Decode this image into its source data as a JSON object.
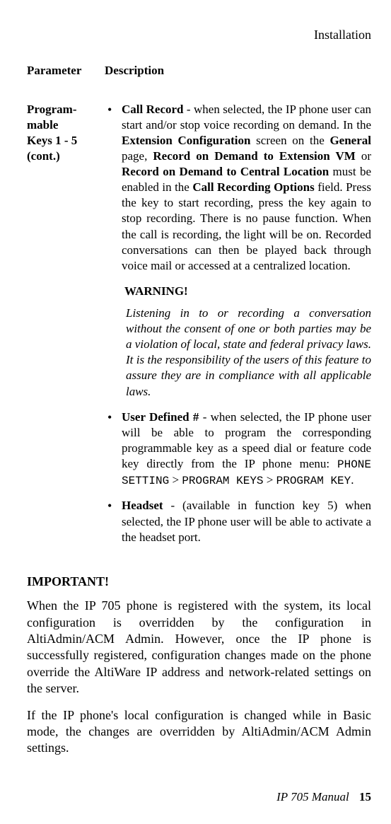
{
  "header": {
    "section": "Installation"
  },
  "table": {
    "headers": {
      "param": "Parameter",
      "desc": "Description"
    },
    "row": {
      "param": "Program-\nmable Keys 1 - 5 (cont.)"
    },
    "bullets": {
      "b1": {
        "lead": "Call Record",
        "t1": " - when selected, the IP phone user can start and/or stop voice recording on demand. In the ",
        "b2": "Extension Configuration",
        "t2": " screen on the ",
        "b3": "General",
        "t3": " page, ",
        "b4": "Record on Demand to Extension VM",
        "t4": " or ",
        "b5": "Record on Demand to Central Location",
        "t5": " must be enabled in the ",
        "b6": "Call Recording Options",
        "t6": " field. Press the key to start recording, press the key again to stop recording. There is no pause function. When the call is recording, the light will be on. Recorded conversations can then be played back through voice mail or accessed at a centralized location."
      },
      "warning": {
        "title": "WARNING!",
        "text": "Listening in to or recording a conversation without the consent of one or both parties may be a violation of local, state and federal privacy laws. It is the responsibility of the users of this feature to assure they are in compliance with all applicable laws."
      },
      "b2": {
        "lead": "User Defined #",
        "t1": " - when selected, the IP phone user will be able to program the corresponding programmable key as a speed dial or feature code key directly from the IP phone menu: ",
        "m1": "PHONE SETTING",
        "gt1": " > ",
        "m2": "PROGRAM KEYS",
        "gt2": " > ",
        "m3": "PROGRAM KEY",
        "end": "."
      },
      "b3": {
        "lead": "Headset",
        "t1": " - (available in function key 5) when selected, the IP phone user will be able to activate a the headset port."
      }
    }
  },
  "important": {
    "title": "IMPORTANT!",
    "p1": "When the IP 705 phone is registered with the system, its local configuration is overridden by the configuration in AltiAdmin/ACM Admin. However, once the IP phone is successfully registered, configuration changes made on the phone override the AltiWare IP address and network-related settings on the server.",
    "p2": "If the IP phone's local configuration is changed while in Basic mode, the changes are overridden by AltiAdmin/ACM Admin settings."
  },
  "footer": {
    "manual": "IP 705 Manual",
    "page": "15"
  }
}
